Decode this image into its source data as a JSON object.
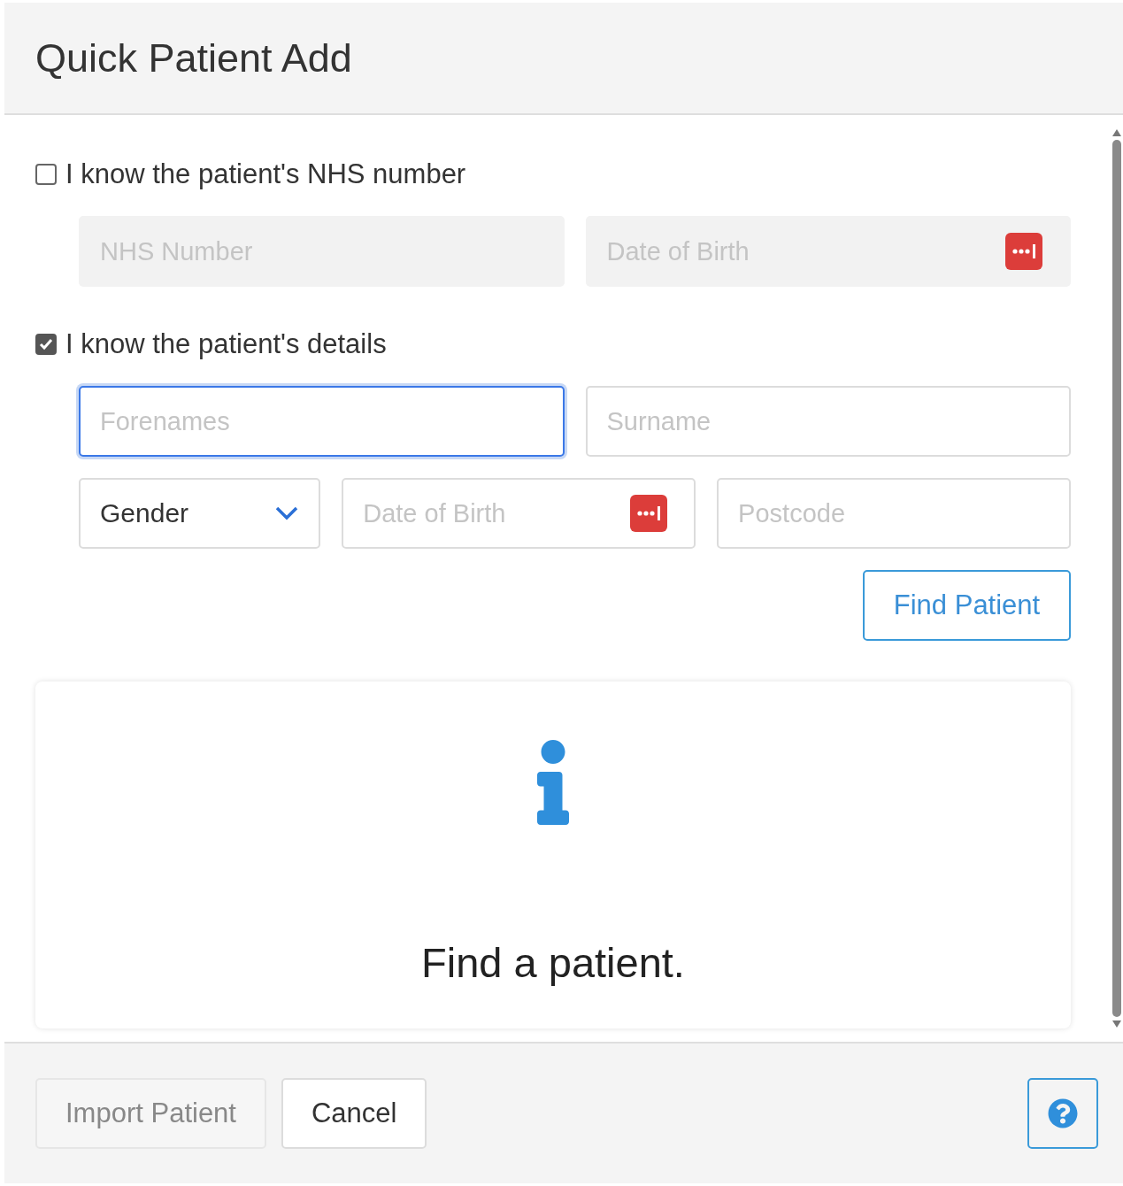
{
  "dialog": {
    "title": "Quick Patient Add"
  },
  "sections": [
    {
      "label": "I know the patient's NHS number",
      "checked": false,
      "rows": [
        [
          {
            "kind": "text",
            "placeholder": "NHS Number",
            "disabled": true,
            "focused": false
          },
          {
            "kind": "date",
            "placeholder": "Date of Birth",
            "disabled": true,
            "focused": false
          }
        ]
      ]
    },
    {
      "label": "I know the patient's details",
      "checked": true,
      "rows": [
        [
          {
            "kind": "text",
            "placeholder": "Forenames",
            "disabled": false,
            "focused": true
          },
          {
            "kind": "text",
            "placeholder": "Surname",
            "disabled": false,
            "focused": false
          }
        ],
        [
          {
            "kind": "select",
            "value": "Gender",
            "disabled": false,
            "focused": false
          },
          {
            "kind": "date",
            "placeholder": "Date of Birth",
            "disabled": false,
            "focused": false
          },
          {
            "kind": "text",
            "placeholder": "Postcode",
            "disabled": false,
            "focused": false
          }
        ]
      ]
    }
  ],
  "find_button": {
    "label": "Find Patient"
  },
  "result_panel": {
    "message": "Find a patient."
  },
  "footer": {
    "buttons": [
      {
        "label": "Import Patient",
        "disabled": true
      },
      {
        "label": "Cancel",
        "disabled": false
      }
    ]
  }
}
